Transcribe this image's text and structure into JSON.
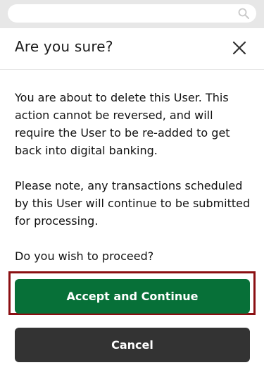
{
  "search": {
    "icon": "search-icon"
  },
  "dialog": {
    "title": "Are you sure?",
    "close_icon": "close-icon",
    "paragraphs": [
      "You are about to delete this User. This action cannot be reversed, and will require the User to be re-added to get back into digital banking.",
      "Please note, any transactions scheduled by this User will continue to be submitted for processing.",
      "Do you wish to proceed?"
    ],
    "accept_label": "Accept and Continue",
    "cancel_label": "Cancel"
  },
  "colors": {
    "accept": "#077038",
    "cancel": "#333333",
    "focus_ring": "#8b0f12",
    "topbar": "#e7e7e7"
  }
}
